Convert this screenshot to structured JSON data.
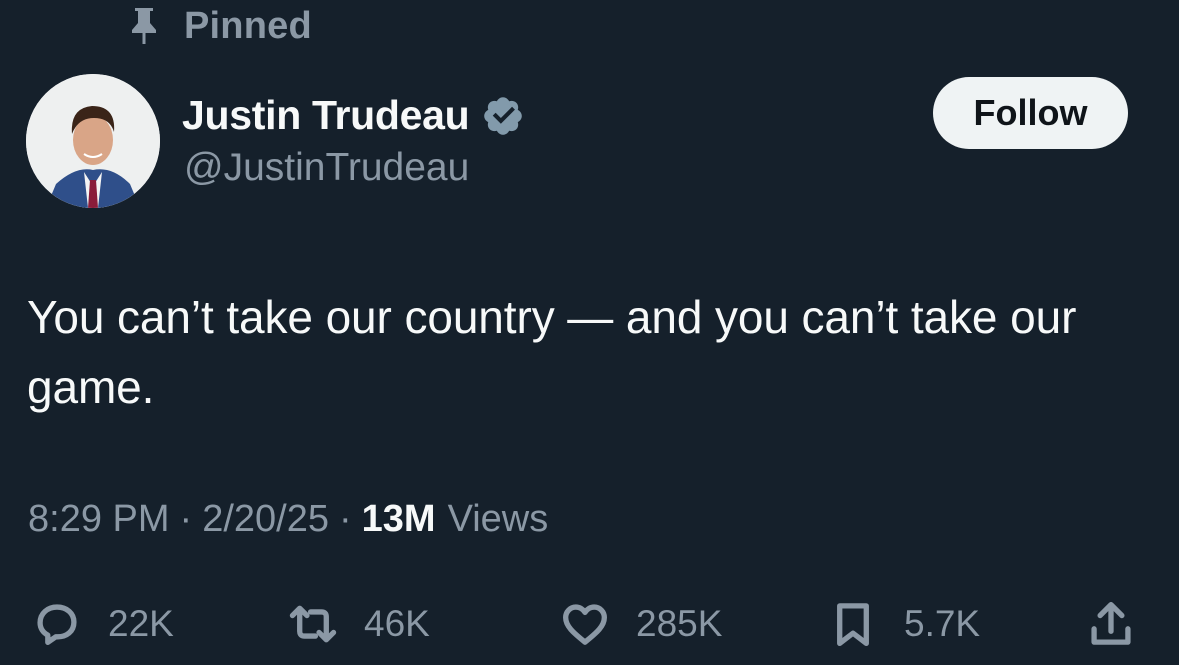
{
  "pinned": {
    "label": "Pinned",
    "icon": "pin-icon"
  },
  "author": {
    "name": "Justin Trudeau",
    "handle": "@JustinTrudeau",
    "verified": true,
    "verified_icon": "verified-badge-icon",
    "avatar": "profile-photo"
  },
  "follow_button": {
    "label": "Follow"
  },
  "tweet": {
    "text": "You can’t take our country — and you can’t take our game."
  },
  "meta": {
    "time": "8:29 PM",
    "date": "2/20/25",
    "separator": "·",
    "views_count": "13M",
    "views_label": "Views"
  },
  "actions": {
    "replies": "22K",
    "retweets": "46K",
    "likes": "285K",
    "bookmarks": "5.7K"
  },
  "colors": {
    "background": "#15202b",
    "text_primary": "#f7f9f9",
    "text_secondary": "#8b98a5",
    "verified": "#829aab",
    "follow_button_bg": "#eff3f4"
  }
}
